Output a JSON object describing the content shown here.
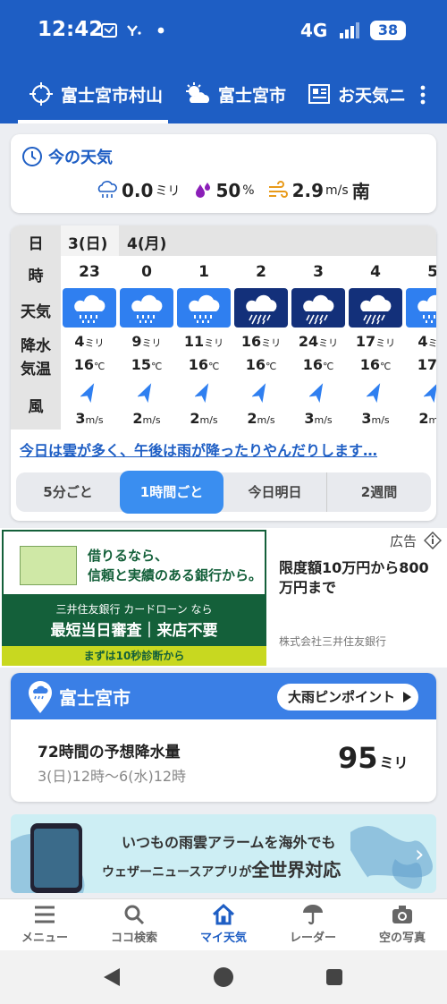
{
  "status": {
    "time": "12:42",
    "network": "4G",
    "battery": "38"
  },
  "tabs": [
    {
      "label": "富士宮市村山"
    },
    {
      "label": "富士宮市"
    },
    {
      "label": "お天気ニ"
    }
  ],
  "now": {
    "title": "今の天気",
    "rain_value": "0.0",
    "rain_unit": "ミリ",
    "prob_value": "50",
    "prob_unit": "%",
    "wind_value": "2.9",
    "wind_unit": "m/s",
    "wind_dir": "南"
  },
  "forecast": {
    "labels": {
      "day": "日",
      "hour": "時",
      "weather": "天気",
      "rain": "降水",
      "temp": "気温",
      "wind": "風"
    },
    "days": [
      "3(日)",
      "4(月)"
    ],
    "units": {
      "rain": "ミリ",
      "temp": "℃",
      "wind": "m/s"
    },
    "hours": [
      {
        "hour": "23",
        "rain": "4",
        "temp": "16",
        "wind": "3",
        "heavy": false
      },
      {
        "hour": "0",
        "rain": "9",
        "temp": "15",
        "wind": "2",
        "heavy": false
      },
      {
        "hour": "1",
        "rain": "11",
        "temp": "16",
        "wind": "2",
        "heavy": false
      },
      {
        "hour": "2",
        "rain": "16",
        "temp": "16",
        "wind": "2",
        "heavy": true
      },
      {
        "hour": "3",
        "rain": "24",
        "temp": "16",
        "wind": "3",
        "heavy": true
      },
      {
        "hour": "4",
        "rain": "17",
        "temp": "16",
        "wind": "3",
        "heavy": true
      },
      {
        "hour": "5",
        "rain": "4",
        "temp": "17",
        "wind": "2",
        "heavy": false
      }
    ],
    "summary": "今日は雲が多く、午後は雨が降ったりやんだりします…",
    "segments": [
      "5分ごと",
      "1時間ごと",
      "今日明日",
      "2週間"
    ]
  },
  "ad": {
    "label": "広告",
    "line1": "借りるなら、",
    "line2": "信頼と実績のある銀行から。",
    "line3": "三井住友銀行 カードローン なら",
    "line4": "最短当日審査｜来店不要",
    "line5": "まずは10秒診断から",
    "text": "限度額10万円から800万円まで",
    "company": "株式会社三井住友銀行"
  },
  "city": {
    "name": "富士宮市",
    "button": "大雨ピンポイント",
    "precip_label": "72時間の予想降水量",
    "precip_range": "3(日)12時〜6(水)12時",
    "precip_value": "95",
    "precip_unit": "ミリ"
  },
  "banner": {
    "line1": "いつもの雨雲アラームを海外でも",
    "line2a": "ウェザーニュースアプリが",
    "line2b": "全世界対応"
  },
  "nav": [
    {
      "label": "メニュー"
    },
    {
      "label": "ココ検索"
    },
    {
      "label": "マイ天気"
    },
    {
      "label": "レーダー"
    },
    {
      "label": "空の写真"
    }
  ],
  "colors": {
    "accent": "#1e5ec4",
    "rain_light": "#2f7ff0",
    "rain_heavy": "#13307a"
  }
}
